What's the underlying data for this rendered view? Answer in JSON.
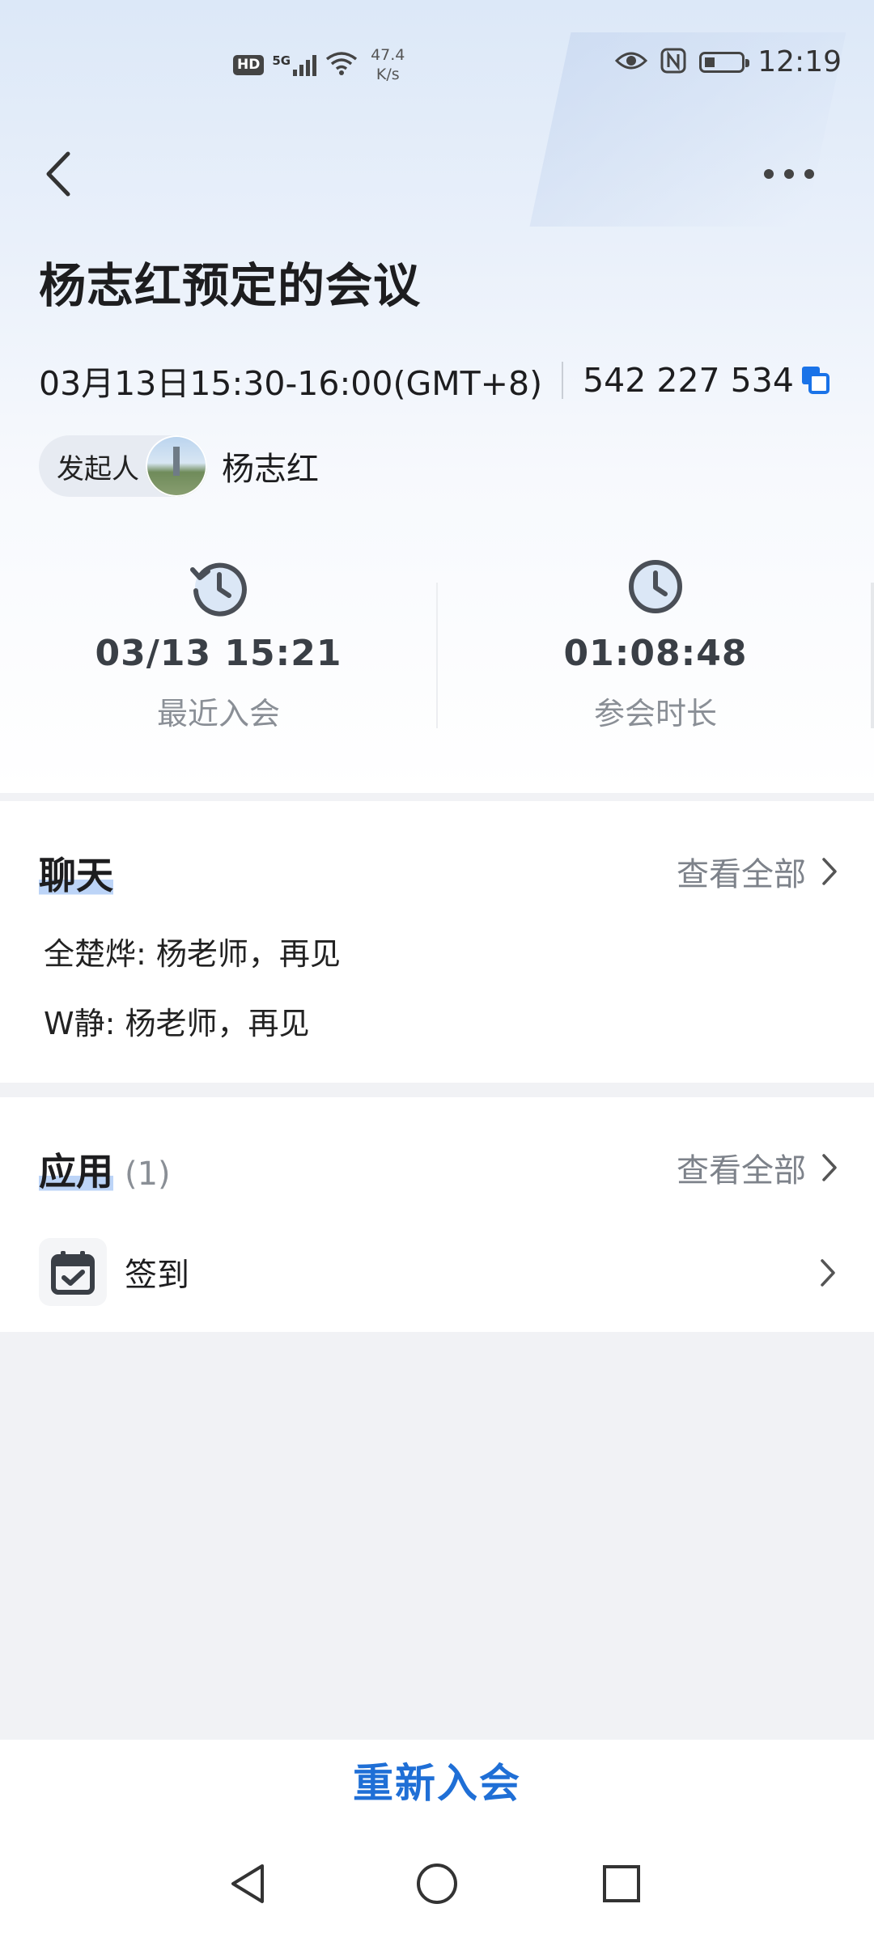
{
  "status_bar": {
    "hd": "HD",
    "signal": "5G",
    "speed_value": "47.4",
    "speed_unit": "K/s",
    "time": "12:19"
  },
  "meeting": {
    "title": "杨志红预定的会议",
    "time_range": "03月13日15:30-16:00(GMT+8)",
    "meeting_id": "542 227 534",
    "organizer_label": "发起人",
    "organizer_name": "杨志红"
  },
  "stats": {
    "last_join_value": "03/13 15:21",
    "last_join_label": "最近入会",
    "duration_value": "01:08:48",
    "duration_label": "参会时长"
  },
  "chat": {
    "title": "聊天",
    "view_all": "查看全部",
    "messages": [
      "全楚烨: 杨老师，再见",
      "W静: 杨老师，再见"
    ]
  },
  "apps": {
    "title": "应用",
    "count": "(1)",
    "view_all": "查看全部",
    "items": [
      {
        "label": "签到",
        "icon": "calendar-check-icon"
      }
    ]
  },
  "actions": {
    "rejoin": "重新入会"
  },
  "colors": {
    "accent": "#1f6fd6",
    "copy_icon": "#1a73e8"
  }
}
